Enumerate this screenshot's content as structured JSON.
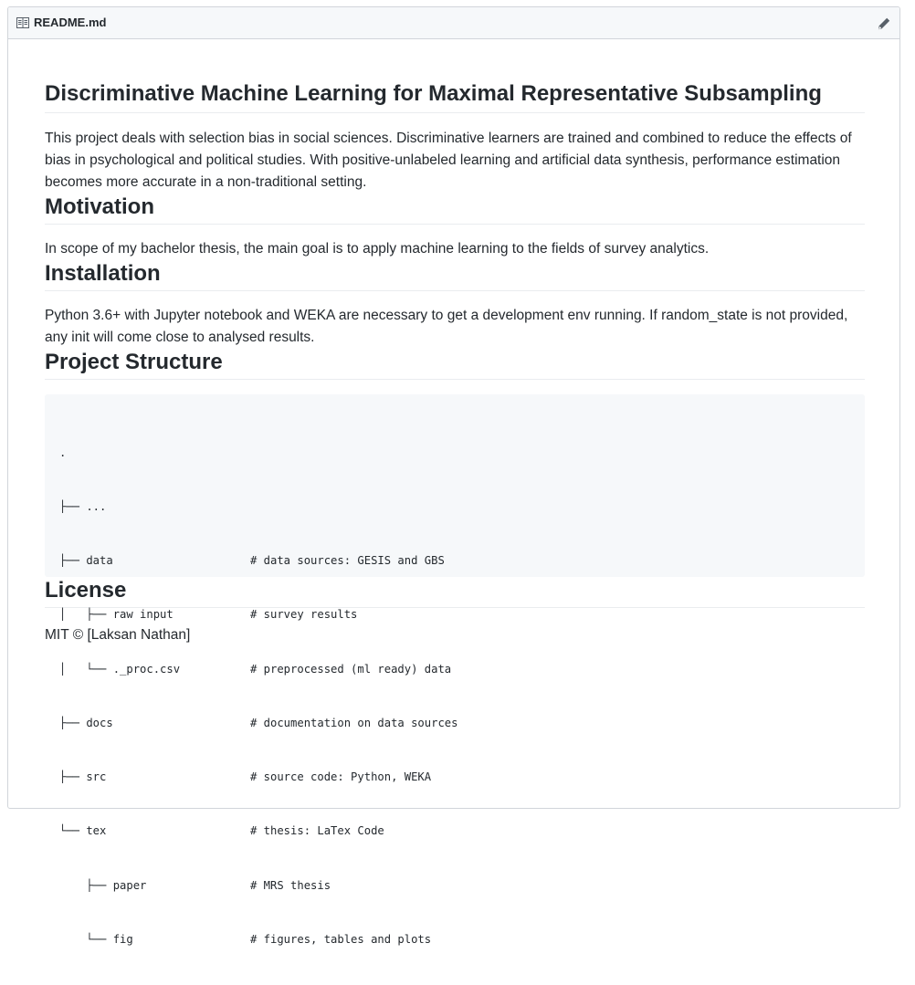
{
  "header": {
    "filename": "README.md"
  },
  "readme": {
    "title": "Discriminative Machine Learning for Maximal Representative Subsampling",
    "intro": "This project deals with selection bias in social sciences. Discriminative learners are trained and combined to reduce the effects of bias in psychological and political studies. With positive-unlabeled learning and artificial data synthesis, performance estimation becomes more accurate in a non-traditional setting.",
    "sections": {
      "motivation": {
        "heading": "Motivation",
        "text": "In scope of my bachelor thesis, the main goal is to apply machine learning to the fields of survey analytics."
      },
      "installation": {
        "heading": "Installation",
        "text": "Python 3.6+ with Jupyter notebook and WEKA are necessary to get a development env running. If random_state is not provided, any init will come close to analysed results."
      },
      "structure": {
        "heading": "Project Structure",
        "tree": [
          {
            "path": ".",
            "comment": ""
          },
          {
            "path": "├── ...",
            "comment": ""
          },
          {
            "path": "├── data",
            "comment": "# data sources: GESIS and GBS"
          },
          {
            "path": "│   ├── raw input",
            "comment": "# survey results"
          },
          {
            "path": "│   └── ._proc.csv",
            "comment": "# preprocessed (ml ready) data"
          },
          {
            "path": "├── docs",
            "comment": "# documentation on data sources"
          },
          {
            "path": "├── src",
            "comment": "# source code: Python, WEKA"
          },
          {
            "path": "└── tex",
            "comment": "# thesis: LaTex Code"
          },
          {
            "path": "    ├── paper",
            "comment": "# MRS thesis"
          },
          {
            "path": "    └── fig",
            "comment": "# figures, tables and plots"
          }
        ]
      },
      "license": {
        "heading": "License",
        "text": "MIT © [Laksan Nathan]"
      }
    }
  },
  "icons": {
    "file": "book-icon",
    "edit": "pencil-icon"
  },
  "colors": {
    "header_bg": "#f6f8fa",
    "border": "#d1d5da",
    "code_bg": "#f6f8fa",
    "text": "#24292e"
  }
}
